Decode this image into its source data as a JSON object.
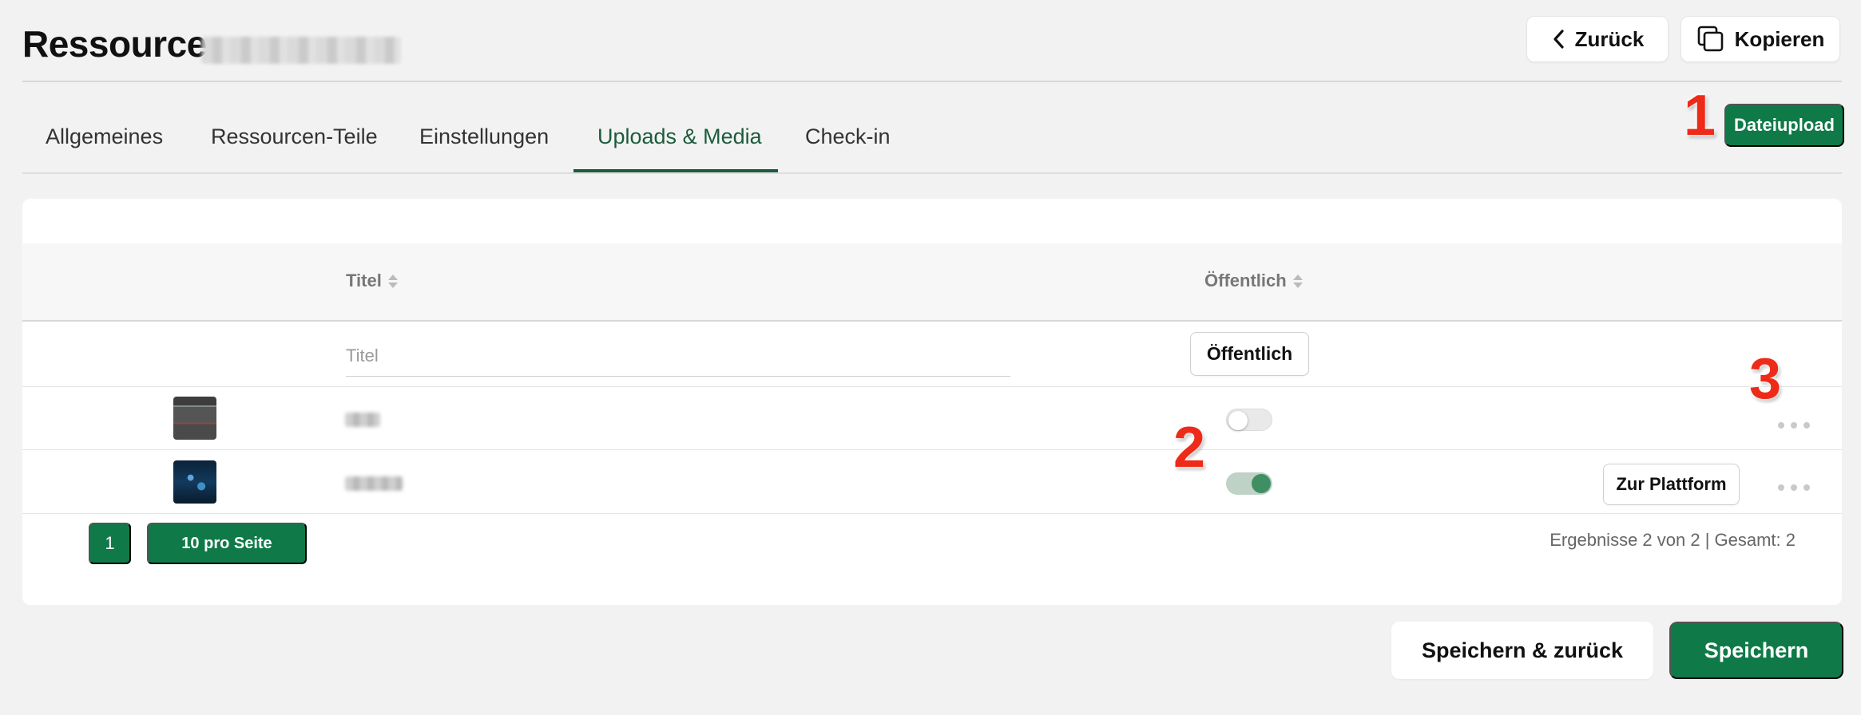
{
  "header": {
    "title": "Ressource",
    "back_label": "Zurück",
    "copy_label": "Kopieren"
  },
  "tabs": [
    {
      "label": "Allgemeines"
    },
    {
      "label": "Ressourcen-Teile"
    },
    {
      "label": "Einstellungen"
    },
    {
      "label": "Uploads & Media",
      "active": true
    },
    {
      "label": "Check-in"
    }
  ],
  "toolbar": {
    "upload_label": "Dateiupload"
  },
  "markers": [
    "1",
    "2",
    "3"
  ],
  "table": {
    "columns": {
      "title": "Titel",
      "public": "Öffentlich"
    },
    "filter": {
      "title_placeholder": "Titel",
      "public_label": "Öffentlich"
    },
    "rows": [
      {
        "public": false
      },
      {
        "public": true,
        "action_label": "Zur Plattform"
      }
    ]
  },
  "pagination": {
    "page": "1",
    "per_page_label": "10 pro Seite",
    "results_text": "Ergebnisse 2 von 2 | Gesamt: 2"
  },
  "footer": {
    "save_back_label": "Speichern & zurück",
    "save_label": "Speichern"
  },
  "colors": {
    "accent": "#0f7a48",
    "tab_active": "#1d5b3d",
    "marker": "#ee2a18"
  }
}
